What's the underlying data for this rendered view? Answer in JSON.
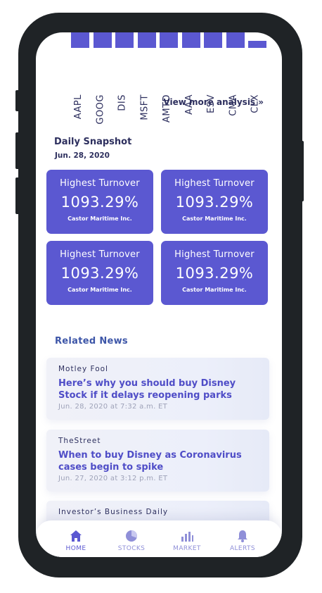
{
  "chart_data": {
    "type": "bar",
    "categories": [
      "AAPL",
      "GOOG",
      "DIS",
      "MSFT",
      "AMTD",
      "AAA",
      "ESV",
      "CMA",
      "CLX"
    ],
    "values": [
      1.0,
      1.0,
      1.0,
      1.0,
      1.0,
      1.0,
      1.0,
      1.0,
      0.45
    ],
    "bar_color": "#5b58d1"
  },
  "analysis": {
    "view_more_label": "View more analysis »"
  },
  "snapshot": {
    "title": "Daily Snapshot",
    "date": "Jun. 28, 2020",
    "cards": [
      {
        "title": "Highest Turnover",
        "value": "1093.29%",
        "company": "Castor Maritime Inc."
      },
      {
        "title": "Highest Turnover",
        "value": "1093.29%",
        "company": "Castor Maritime Inc."
      },
      {
        "title": "Highest Turnover",
        "value": "1093.29%",
        "company": "Castor Maritime Inc."
      },
      {
        "title": "Highest Turnover",
        "value": "1093.29%",
        "company": "Castor Maritime Inc."
      }
    ]
  },
  "news": {
    "title": "Related News",
    "items": [
      {
        "source": "Motley Fool",
        "headline": "Here’s why you should buy Disney Stock if it delays reopening parks",
        "meta": "Jun. 28, 2020 at 7:32 a.m. ET"
      },
      {
        "source": "TheStreet",
        "headline": "When to buy Disney as Coronavirus cases begin to spike",
        "meta": "Jun. 27, 2020 at 3:12 p.m. ET"
      },
      {
        "source": "Investor’s Business Daily",
        "headline": "",
        "meta": ""
      }
    ]
  },
  "tabbar": {
    "tabs": [
      {
        "label": "HOME",
        "icon": "home-icon",
        "active": true
      },
      {
        "label": "STOCKS",
        "icon": "pie-chart-icon",
        "active": false
      },
      {
        "label": "MARKET",
        "icon": "bar-chart-icon",
        "active": false
      },
      {
        "label": "ALERTS",
        "icon": "bell-icon",
        "active": false
      }
    ]
  },
  "colors": {
    "accent": "#5b58d1",
    "text_dark": "#2d2f5e",
    "news_heading": "#3d56a8",
    "muted": "#9ea2b8"
  }
}
